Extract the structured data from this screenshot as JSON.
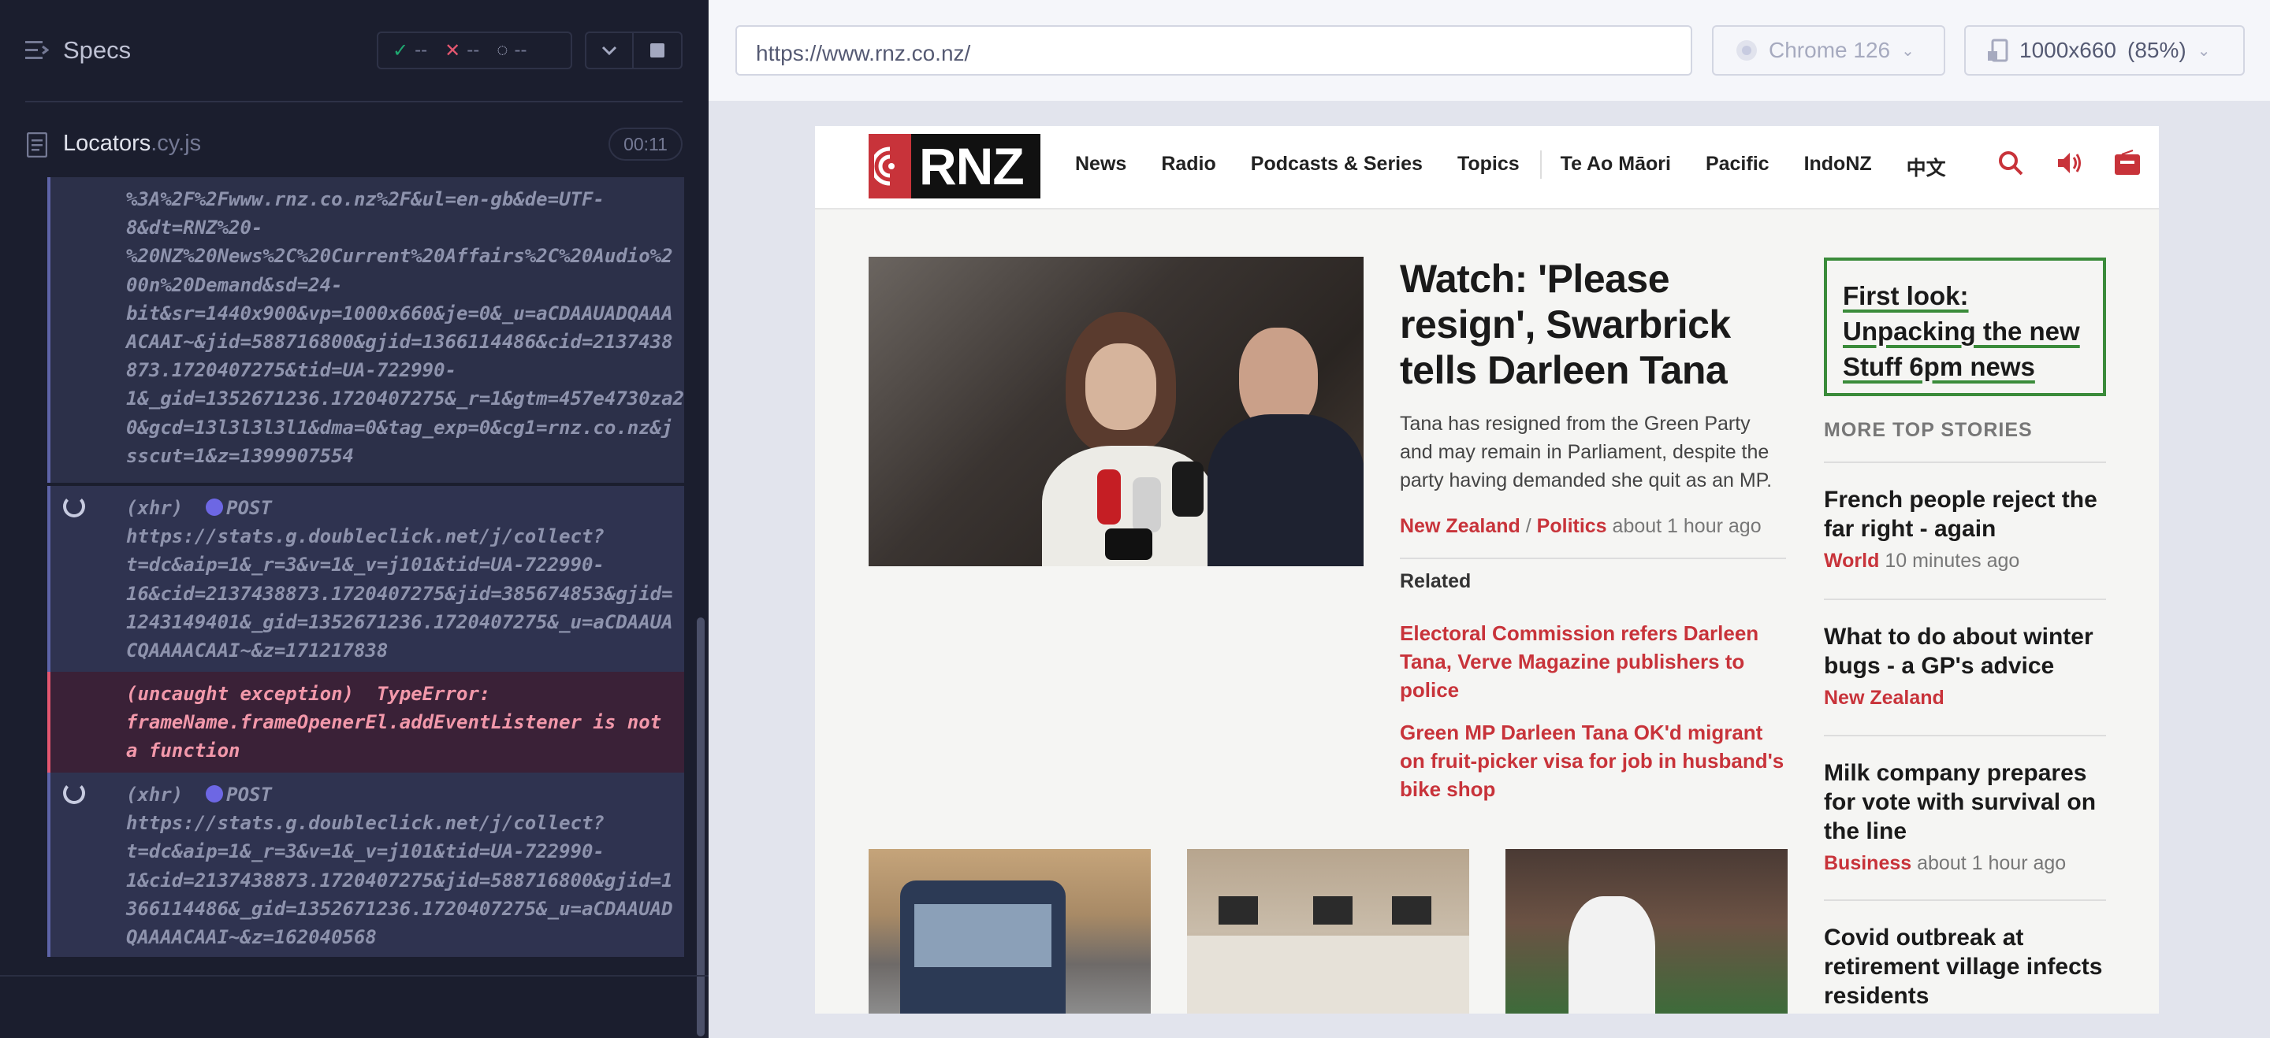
{
  "reporter": {
    "specs_label": "Specs",
    "stats": {
      "passed": "--",
      "failed": "--",
      "pending": "--"
    },
    "spec_file": {
      "name": "Locators",
      "ext": ".cy.js",
      "duration": "00:11"
    },
    "log": [
      {
        "text": "%3A%2F%2Fwww.rnz.co.nz%2F&ul=en-gb&de=UTF-\n8&dt=RNZ%20-\n%20NZ%20News%2C%20Current%20Affairs%2C%20Audio%2\n00n%20Demand&sd=24-\nbit&sr=1440x900&vp=1000x660&je=0&_u=aCDAAUADQAAA\nACAAI~&jid=588716800&gjid=1366114486&cid=2137438\n873.1720407275&tid=UA-722990-\n1&_gid=1352671236.1720407275&_r=1&gtm=457e4730za20\n0&gcd=13l3l3l3l1&dma=0&tag_exp=0&cg1=rnz.co.nz&j\nsscut=1&z=1399907554"
      },
      {
        "prefix": "(xhr)  ",
        "method": "POST",
        "text": "https://stats.g.doubleclick.net/j/collect?\nt=dc&aip=1&_r=3&v=1&_v=j101&tid=UA-722990-\n16&cid=2137438873.1720407275&jid=385674853&gjid=\n1243149401&_gid=1352671236.1720407275&_u=aCDAAUA\nCQAAAACAAI~&z=171217838"
      },
      {
        "text": "(uncaught exception)  TypeError:\nframeName.frameOpenerEl.addEventListener is not\na function"
      },
      {
        "prefix": "(xhr)  ",
        "method": "POST",
        "text": "https://stats.g.doubleclick.net/j/collect?\nt=dc&aip=1&_r=3&v=1&_v=j101&tid=UA-722990-\n1&cid=2137438873.1720407275&jid=588716800&gjid=1\n366114486&_gid=1352671236.1720407275&_u=aCDAAUAD\nQAAAACAAI~&z=162040568"
      }
    ]
  },
  "aut": {
    "url": "https://www.rnz.co.nz/",
    "browser": "Chrome 126",
    "viewport": "1000x660",
    "scale": "(85%)"
  },
  "site": {
    "logo": "RNZ",
    "nav": [
      "News",
      "Radio",
      "Podcasts & Series",
      "Topics",
      "Te Ao Māori",
      "Pacific",
      "IndoNZ",
      "中文"
    ],
    "lead": {
      "headline": "Watch: 'Please resign', Swarbrick tells Darleen Tana",
      "summary": "Tana has resigned from the Green Party and may remain in Parliament, despite the party having demanded she quit as an MP.",
      "cat1": "New Zealand",
      "sep": " / ",
      "cat2": "Politics",
      "time": "about 1 hour ago",
      "related_label": "Related",
      "related": [
        "Electoral Commission refers Darleen Tana, Verve Magazine publishers to police",
        "Green MP Darleen Tana OK'd migrant on fruit-picker visa for job in husband's bike shop"
      ]
    },
    "promo": {
      "line1": "First look:",
      "line2": "Unpacking the new",
      "line3": "Stuff 6pm news"
    },
    "more_label": "MORE TOP STORIES",
    "stories": [
      {
        "title": "French people reject the far right - again",
        "cat": "World",
        "time": "10 minutes ago"
      },
      {
        "title": "What to do about winter bugs - a GP's advice",
        "cat": "New Zealand",
        "time": ""
      },
      {
        "title": "Milk company prepares for vote with survival on the line",
        "cat": "Business",
        "time": "about 1 hour ago"
      },
      {
        "title": "Covid outbreak at retirement village infects residents",
        "cat": "",
        "time": ""
      }
    ],
    "colors": {
      "brand_red": "#c8333a",
      "promo_green": "#3a8b3a"
    }
  }
}
